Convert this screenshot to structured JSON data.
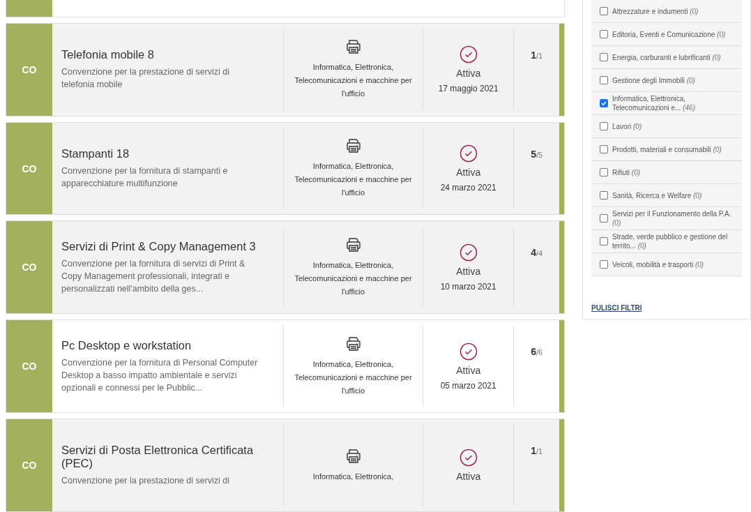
{
  "results": [
    {
      "badge": "CO",
      "title": "Telefonia mobile 8",
      "description": "Convenzione per la prestazione di servizi di telefonia mobile",
      "category": "Informatica, Elettronica, Telecomunicazioni e macchine per l'ufficio",
      "status": "Attiva",
      "date": "17 maggio 2021",
      "count": "1",
      "total": "/1",
      "highlighted": false
    },
    {
      "badge": "CO",
      "title": "Stampanti 18",
      "description": "Convenzione per la fornitura di stampanti e apparecchiature multifunzione",
      "category": "Informatica, Elettronica, Telecomunicazioni e macchine per l'ufficio",
      "status": "Attiva",
      "date": "24 marzo 2021",
      "count": "5",
      "total": "/5",
      "highlighted": false
    },
    {
      "badge": "CO",
      "title": "Servizi di Print & Copy Management 3",
      "description": "Convenzione per la fornitura di servizi di Print & Copy Management professionali, integrati e personalizzati nell'ambito della ges...",
      "category": "Informatica, Elettronica, Telecomunicazioni e macchine per l'ufficio",
      "status": "Attiva",
      "date": "10 marzo 2021",
      "count": "4",
      "total": "/4",
      "highlighted": false
    },
    {
      "badge": "CO",
      "title": "Pc Desktop e workstation",
      "description": "Convenzione per la fornitura di Personal Computer Desktop a basso impatto ambientale e servizi opzionali e connessi per le Pubblic...",
      "category": "Informatica, Elettronica, Telecomunicazioni e macchine per l'ufficio",
      "status": "Attiva",
      "date": "05 marzo 2021",
      "count": "6",
      "total": "/6",
      "highlighted": true
    },
    {
      "badge": "CO",
      "title": "Servizi di Posta Elettronica Certificata (PEC)",
      "description": "Convenzione per la prestazione di servizi di",
      "category": "Informatica, Elettronica,",
      "status": "Attiva",
      "count": "1",
      "total": "/1",
      "highlighted": false
    }
  ],
  "filters": [
    {
      "label": "Attrezzature e indumenti",
      "count": "(0)",
      "checked": false
    },
    {
      "label": "Editoria, Eventi e Comunicazione",
      "count": "(0)",
      "checked": false
    },
    {
      "label": "Energia, carburanti e lubrificanti",
      "count": "(0)",
      "checked": false
    },
    {
      "label": "Gestione degli Immobili",
      "count": "(0)",
      "checked": false
    },
    {
      "label": "Informatica, Elettronica, Telecomunicazioni e...",
      "count": "(46)",
      "checked": true
    },
    {
      "label": "Lavori",
      "count": "(0)",
      "checked": false
    },
    {
      "label": "Prodotti, materiali e consumabili",
      "count": "(0)",
      "checked": false
    },
    {
      "label": "Rifiuti",
      "count": "(0)",
      "checked": false
    },
    {
      "label": "Sanità, Ricerca e Welfare",
      "count": "(0)",
      "checked": false
    },
    {
      "label": "Servizi per il Funzionamento della P.A.",
      "count": "(0)",
      "checked": false
    },
    {
      "label": "Strade, verde pubblico e gestione del territo...",
      "count": "(0)",
      "checked": false
    },
    {
      "label": "Veicoli, mobilità e trasporti",
      "count": "(0)",
      "checked": false
    }
  ],
  "clear_filters": "PULISCI FILTRI"
}
